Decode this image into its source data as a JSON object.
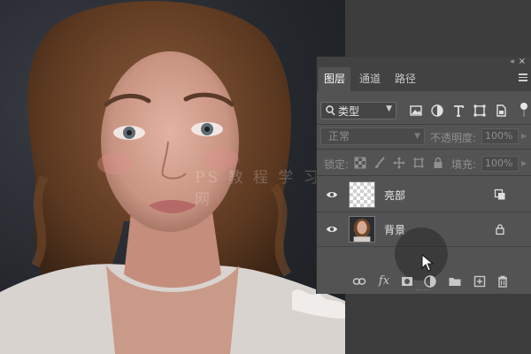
{
  "panel": {
    "tabs": [
      {
        "label": "图层",
        "active": true
      },
      {
        "label": "通道",
        "active": false
      },
      {
        "label": "路径",
        "active": false
      }
    ],
    "filter": {
      "label": "类型"
    },
    "blend_mode": "正常",
    "opacity_label": "不透明度:",
    "opacity_value": "100%",
    "lock_label": "锁定:",
    "fill_label": "填充:",
    "fill_value": "100%"
  },
  "layers": [
    {
      "name": "亮部",
      "visible": true,
      "thumbnail": "transparent-checkerboard",
      "badge": "layer-style-icon"
    },
    {
      "name": "背景",
      "visible": true,
      "thumbnail": "portrait",
      "badge": "lock-icon"
    }
  ],
  "watermark": "PS 教 程 学 习 网",
  "colors": {
    "panel_bg": "#535353",
    "tab_bar": "#424242",
    "text": "#e8e8e8",
    "dim_text": "#8f8f8f",
    "canvas_bg": "#23262b"
  }
}
